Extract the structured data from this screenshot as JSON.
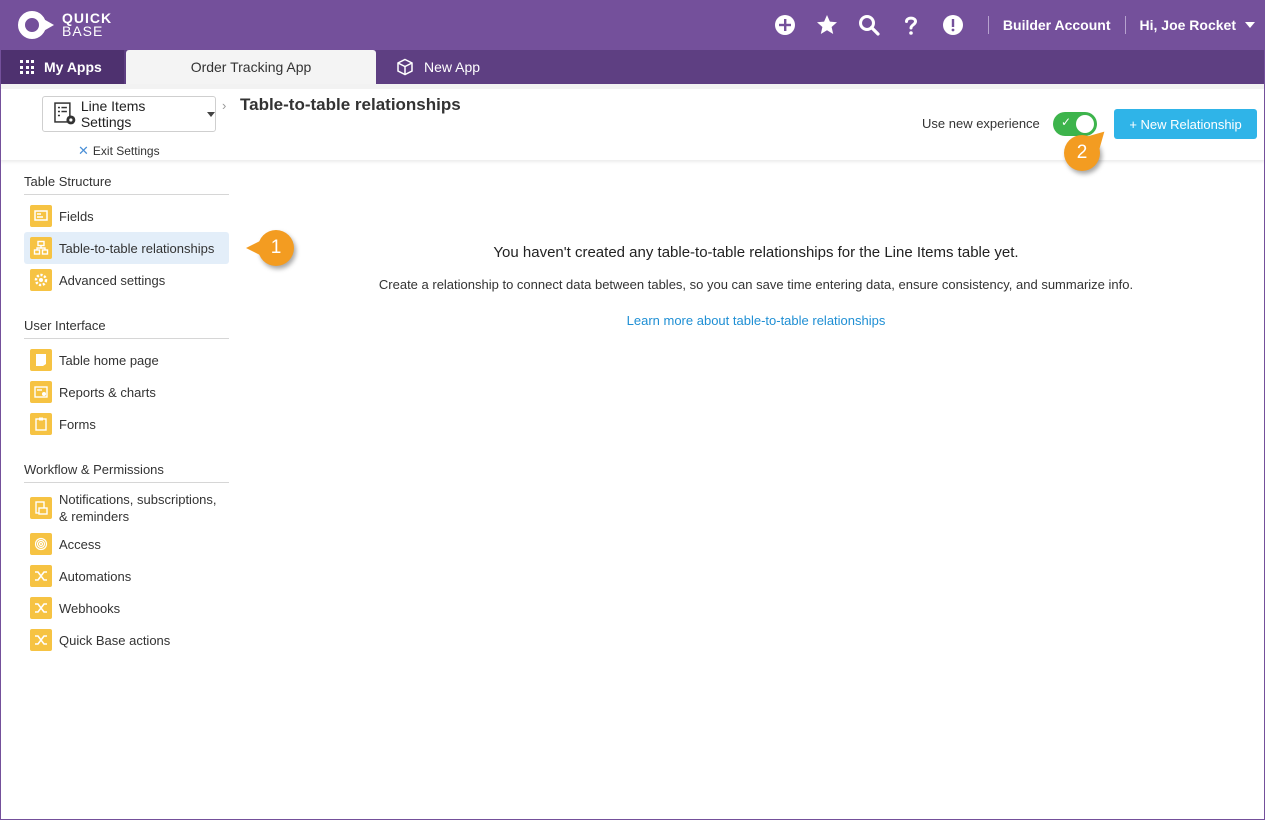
{
  "brand": {
    "line1": "QUICK",
    "line2": "BASE"
  },
  "topbar": {
    "icons": [
      "plus-circle-icon",
      "star-icon",
      "search-icon",
      "help-icon",
      "alert-icon"
    ],
    "account": "Builder Account",
    "user": "Hi, Joe Rocket",
    "color": "#74509b"
  },
  "tabs": {
    "my_apps": "My Apps",
    "active": "Order Tracking App",
    "new_app": "New App"
  },
  "header": {
    "settings_dropdown": "Line Items Settings",
    "exit_settings": "Exit Settings",
    "title": "Table-to-table relationships",
    "new_experience_label": "Use new experience",
    "toggle_on": true,
    "new_relationship": "+ New Relationship",
    "accent": "#2fb4e8"
  },
  "callouts": {
    "one": "1",
    "two": "2",
    "color": "#f39c21"
  },
  "sidebar": {
    "table_structure": {
      "title": "Table Structure",
      "items": [
        "Fields",
        "Table-to-table relationships",
        "Advanced settings"
      ]
    },
    "user_interface": {
      "title": "User Interface",
      "items": [
        "Table home page",
        "Reports & charts",
        "Forms"
      ]
    },
    "workflow": {
      "title": "Workflow & Permissions",
      "items": [
        "Notifications, subscriptions,",
        "& reminders",
        "Access",
        "Automations",
        "Webhooks",
        "Quick Base actions"
      ]
    }
  },
  "main": {
    "empty_title": "You haven't created any table-to-table relationships for the Line Items table yet.",
    "empty_sub": "Create a relationship to connect data between tables, so you can save time entering data, ensure consistency, and summarize info.",
    "learn_more": "Learn more about table-to-table relationships"
  }
}
